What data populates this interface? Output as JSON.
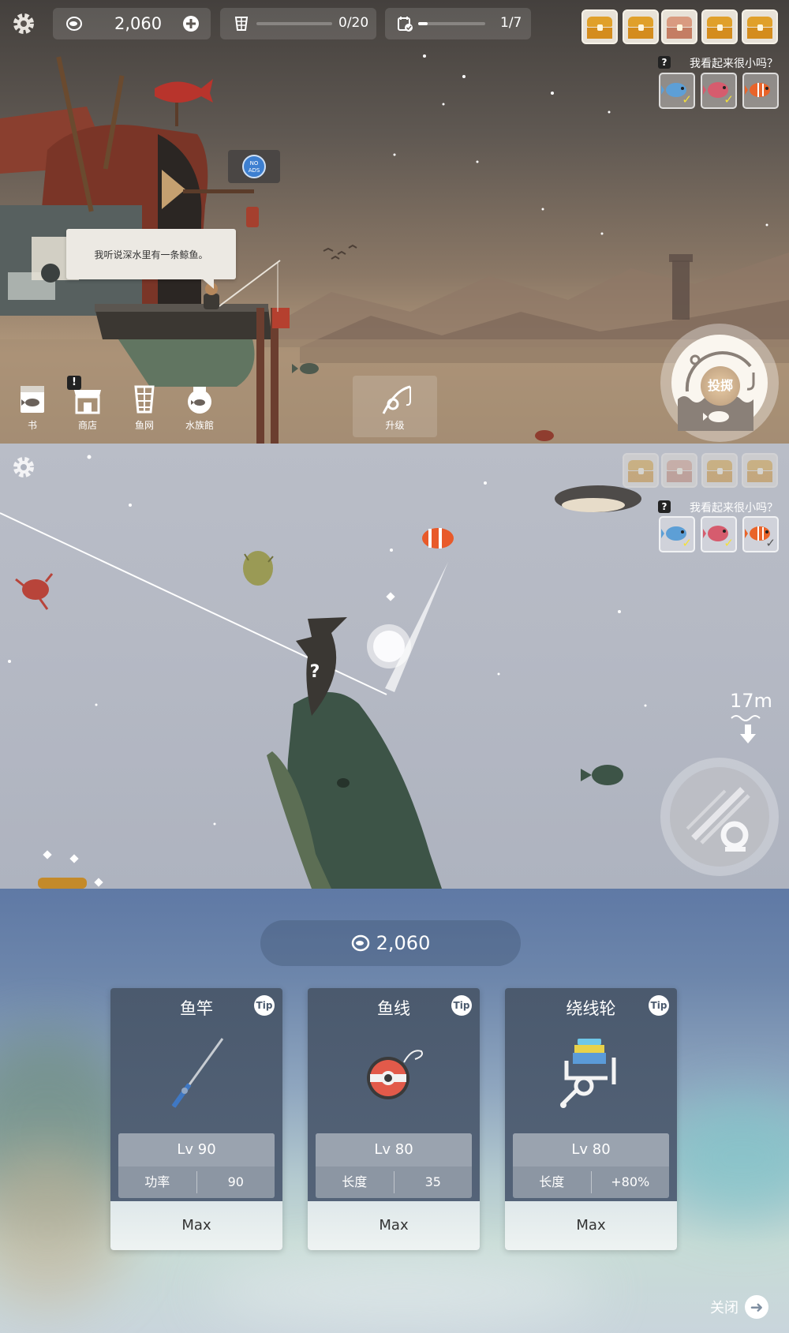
{
  "hud": {
    "coins": "2,060",
    "net_capacity": "0/20",
    "quests": "1/7"
  },
  "quest": {
    "help": "?",
    "label": "我看起来很小吗？"
  },
  "dialog": {
    "text": "我听说深水里有一条鲸鱼。"
  },
  "no_ads": {
    "line1": "NO",
    "line2": "ADS"
  },
  "nav": {
    "items": [
      {
        "label": "书",
        "icon": "book-icon"
      },
      {
        "label": "商店",
        "icon": "shop-icon",
        "badge": "!"
      },
      {
        "label": "鱼网",
        "icon": "fishnet-icon"
      },
      {
        "label": "水族館",
        "icon": "aquarium-icon"
      }
    ]
  },
  "upgrade_button": {
    "label": "升级"
  },
  "cast_button": {
    "label": "投掷"
  },
  "underwater": {
    "depth": "17m",
    "unknown_fish_mark": "?"
  },
  "upgrade_panel": {
    "coins": "2,060",
    "tip_label": "Tip",
    "cards": [
      {
        "title": "鱼竿",
        "level": "Lv 90",
        "stat_name": "功率",
        "stat_value": "90",
        "action": "Max"
      },
      {
        "title": "鱼线",
        "level": "Lv 80",
        "stat_name": "长度",
        "stat_value": "35",
        "action": "Max"
      },
      {
        "title": "绕线轮",
        "level": "Lv 80",
        "stat_name": "长度",
        "stat_value": "+80%",
        "action": "Max"
      }
    ],
    "close_label": "关闭"
  },
  "colors": {
    "accent_gold": "#e0a02a",
    "check_yellow": "#f4e03a",
    "card_bg": "#4b5a6e"
  }
}
